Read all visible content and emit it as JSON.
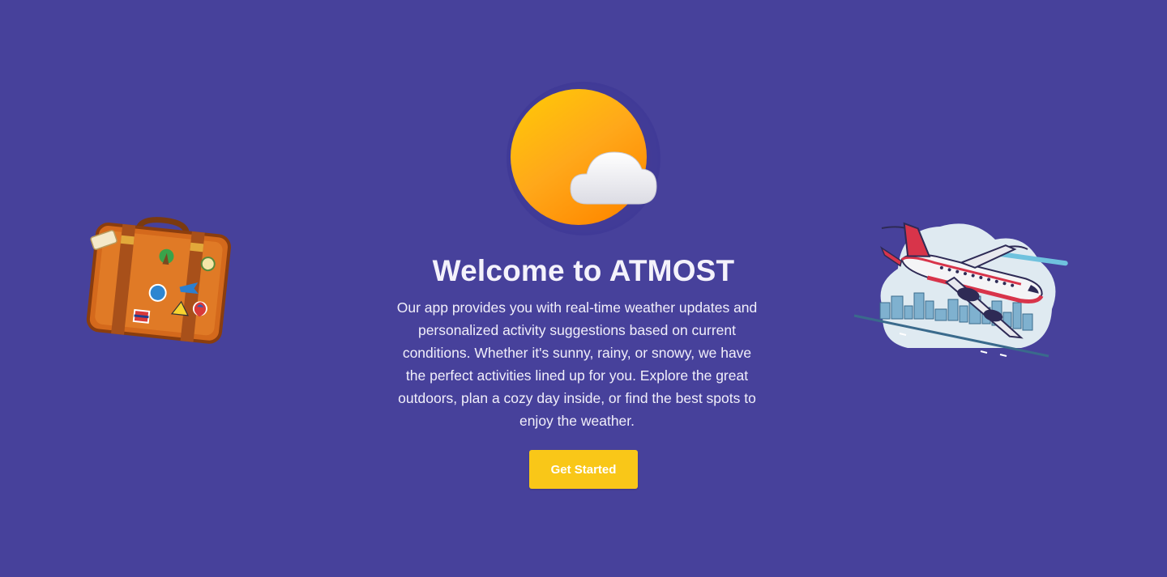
{
  "hero": {
    "title": "Welcome to ATMOST",
    "description": "Our app provides you with real-time weather updates and personalized activity suggestions based on current conditions. Whether it's sunny, rainy, or snowy, we have the perfect activities lined up for you. Explore the great outdoors, plan a cozy day inside, or find the best spots to enjoy the weather.",
    "cta_label": "Get Started"
  },
  "illustrations": {
    "logo": "sun-cloud-icon",
    "left": "suitcase-illustration",
    "right": "airplane-city-illustration"
  },
  "colors": {
    "background": "#47419b",
    "accent": "#f9c718",
    "sun": "#ffa500",
    "text": "#f4f2fb"
  }
}
